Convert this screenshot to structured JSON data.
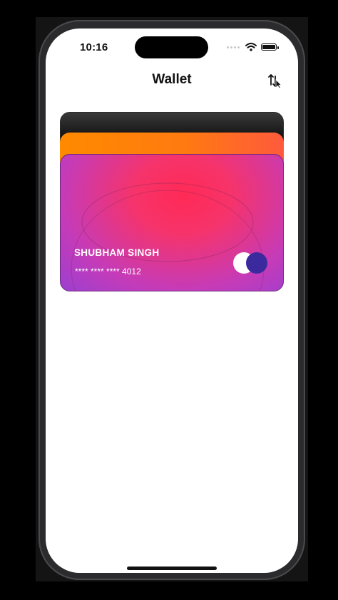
{
  "status_bar": {
    "time": "10:16"
  },
  "header": {
    "title": "Wallet",
    "sort_icon": "sort-arrows-icon"
  },
  "cards": {
    "front": {
      "holder_name": "SHUBHAM SINGH",
      "number": "**** **** **** 4012",
      "brand_icon": "card-brand-circles-icon"
    },
    "colors": {
      "black": "#111111",
      "orange": "#ff8a00",
      "pink": "#ff2a55",
      "purple": "#9b3fd1"
    }
  }
}
